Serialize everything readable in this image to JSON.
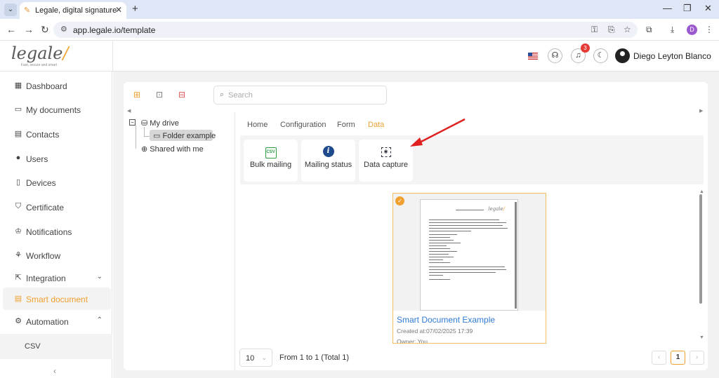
{
  "browser": {
    "tab_title": "Legale, digital signature",
    "url": "app.legale.io/template",
    "profile_initial": "D"
  },
  "header": {
    "logo_text": "legale",
    "logo_tagline": "Fast, secure and smart",
    "notification_count": "3",
    "user_name": "Diego Leyton Blanco"
  },
  "sidebar": {
    "items": [
      {
        "label": "Dashboard",
        "icon": "dashboard-icon"
      },
      {
        "label": "My documents",
        "icon": "folder-icon"
      },
      {
        "label": "Contacts",
        "icon": "contacts-icon"
      },
      {
        "label": "Users",
        "icon": "user-icon"
      },
      {
        "label": "Devices",
        "icon": "device-icon"
      },
      {
        "label": "Certificate",
        "icon": "shield-icon"
      },
      {
        "label": "Notifications",
        "icon": "bell-icon"
      },
      {
        "label": "Workflow",
        "icon": "workflow-icon"
      },
      {
        "label": "Integration",
        "icon": "integration-icon"
      },
      {
        "label": "Smart document",
        "icon": "smart-document-icon"
      },
      {
        "label": "Automation",
        "icon": "gear-icon"
      }
    ],
    "sub_item": "CSV",
    "collapse_glyph": "‹"
  },
  "toolbar": {
    "search_placeholder": "Search"
  },
  "tree": {
    "root": "My drive",
    "child": "Folder example",
    "shared": "Shared with me"
  },
  "tabs": [
    "Home",
    "Configuration",
    "Form",
    "Data"
  ],
  "active_tab": "Data",
  "actions": [
    {
      "label": "Bulk mailing",
      "icon": "csv-icon"
    },
    {
      "label": "Mailing status",
      "icon": "info-icon"
    },
    {
      "label": "Data capture",
      "icon": "scan-icon"
    }
  ],
  "document": {
    "title": "Smart Document Example",
    "created": "Created at:07/02/2025 17:39",
    "owner": "Owner: You"
  },
  "pagination": {
    "page_size": "10",
    "range_text": "From 1 to 1 (Total 1)",
    "current_page": "1"
  },
  "colors": {
    "accent": "#f0a030",
    "link": "#2f7bd6"
  }
}
